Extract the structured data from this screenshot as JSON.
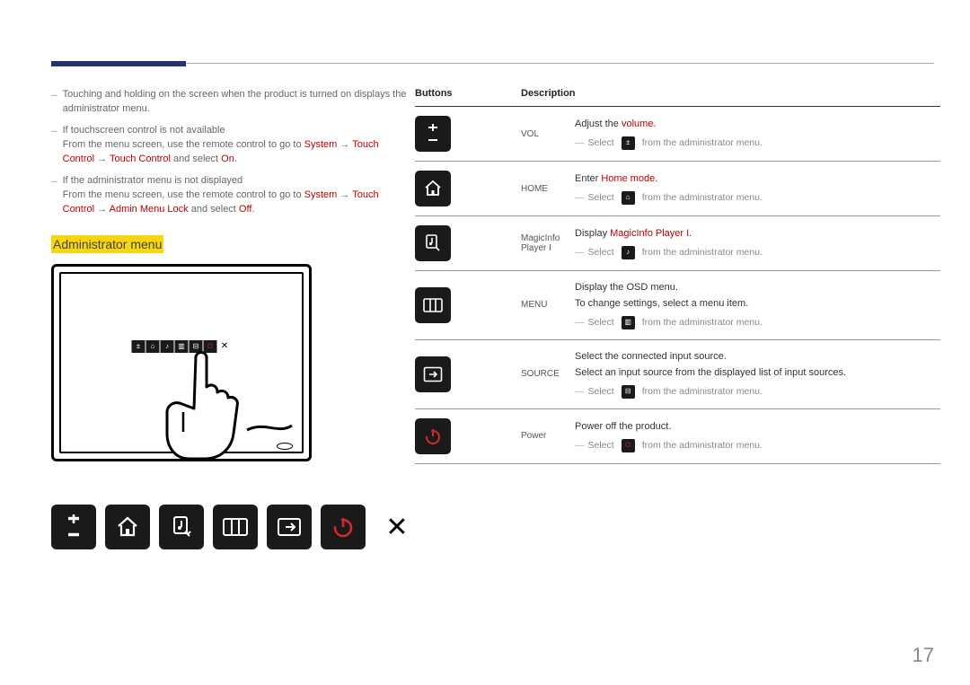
{
  "page_number": "17",
  "left": {
    "note1": "Touching and holding on the screen when the product is turned on displays the administrator menu.",
    "note2_title": "If touchscreen control is not available",
    "note2_body_a": "From the menu screen, use the remote control to go to ",
    "note2_body_b": " and select ",
    "note3_title": "If the administrator menu is not displayed",
    "note3_body_a": "From the menu screen, use the remote control to go to ",
    "note3_body_b": " and select ",
    "highlight": "Administrator menu"
  },
  "table": {
    "col1": "Buttons",
    "col2": "Description",
    "rows": [
      {
        "icon": "volume",
        "btn": "VOL",
        "desc_a": "Adjust the ",
        "desc_b": "volume.",
        "note_a": "Select ",
        "note_b": " from the administrator menu.",
        "tiny": "volume"
      },
      {
        "icon": "home",
        "btn": "HOME",
        "desc_a": "Enter ",
        "desc_b": "Home mode.",
        "note_a": "Select ",
        "note_b": " from the administrator menu.",
        "tiny": "home"
      },
      {
        "icon": "note",
        "btn": "MagicInfo Player I",
        "desc_a": "Display ",
        "desc_b": "MagicInfo Player I.",
        "note_a": "Select ",
        "note_b": " from the administrator menu.",
        "tiny": "note"
      },
      {
        "icon": "menu",
        "btn": "MENU",
        "desc_a": "Display the OSD menu.",
        "desc_b": "To change settings, select a menu item.",
        "note_a": "Select ",
        "note_b": " from the administrator menu.",
        "tiny": "menu"
      },
      {
        "icon": "source",
        "btn": "SOURCE",
        "desc_a": "Select the connected input source.",
        "desc_b": "Select an input source from the displayed list of input sources.",
        "note_a": "Select ",
        "note_b": " from the administrator menu.",
        "tiny": "source"
      },
      {
        "icon": "power",
        "btn": "Power",
        "desc_a": "Power off the product.",
        "desc_b": "",
        "note_a": "Select ",
        "note_b": " from the administrator menu.",
        "tiny": "power"
      }
    ]
  }
}
